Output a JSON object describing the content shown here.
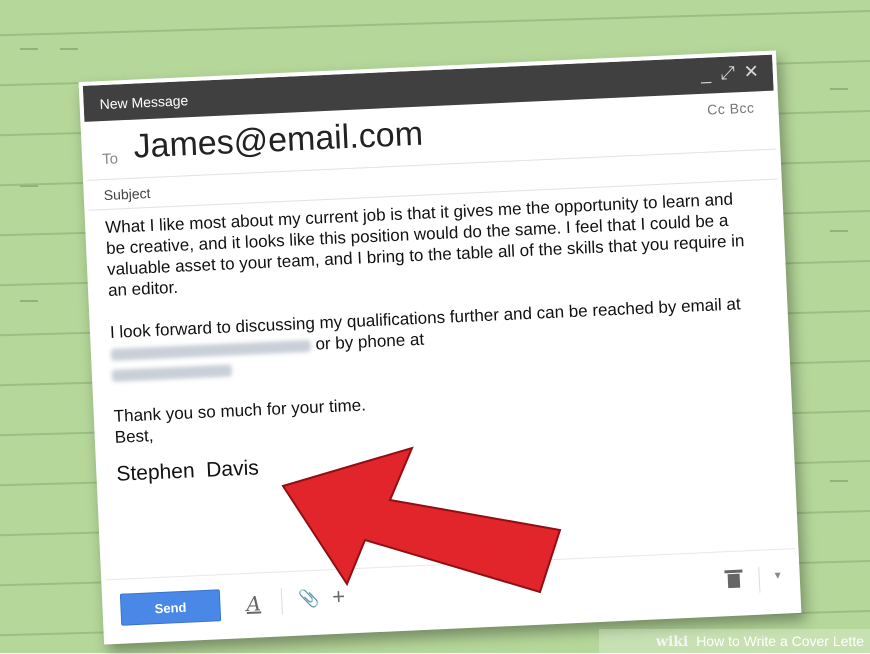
{
  "compose": {
    "window_title": "New Message",
    "window_controls": [
      "_",
      "⤢",
      "✕"
    ],
    "to_label": "To",
    "to_value": "James@email.com",
    "cc_bcc": "Cc Bcc",
    "subject_label": "Subject",
    "body_paragraph_1": "What I like most about my current job is that it gives me the opportunity to learn and be creative, and it looks like this position would do the same. I feel that I could be a valuable asset to your team, and I bring to the table all of the skills that you require in an editor.",
    "body_paragraph_2_start": "I look forward to discussing my qualifications further and can be reached by email at",
    "body_paragraph_2_mid": "or by phone at",
    "closing_line": "Thank you so much for your time.",
    "closing_word": "Best,",
    "signature": "Stephen  Davis",
    "send_label": "Send",
    "format_icon_glyph": "A",
    "attach_icon_glyph": "📎",
    "insert_icon_glyph": "+",
    "more_icon_glyph": "▾"
  },
  "watermark": {
    "logo": "wiki",
    "text": "How to Write a Cover Lette"
  },
  "colors": {
    "background": "#b5d79a",
    "titlebar": "#404040",
    "send_button": "#4a88e8",
    "arrow": "#e2242b"
  }
}
